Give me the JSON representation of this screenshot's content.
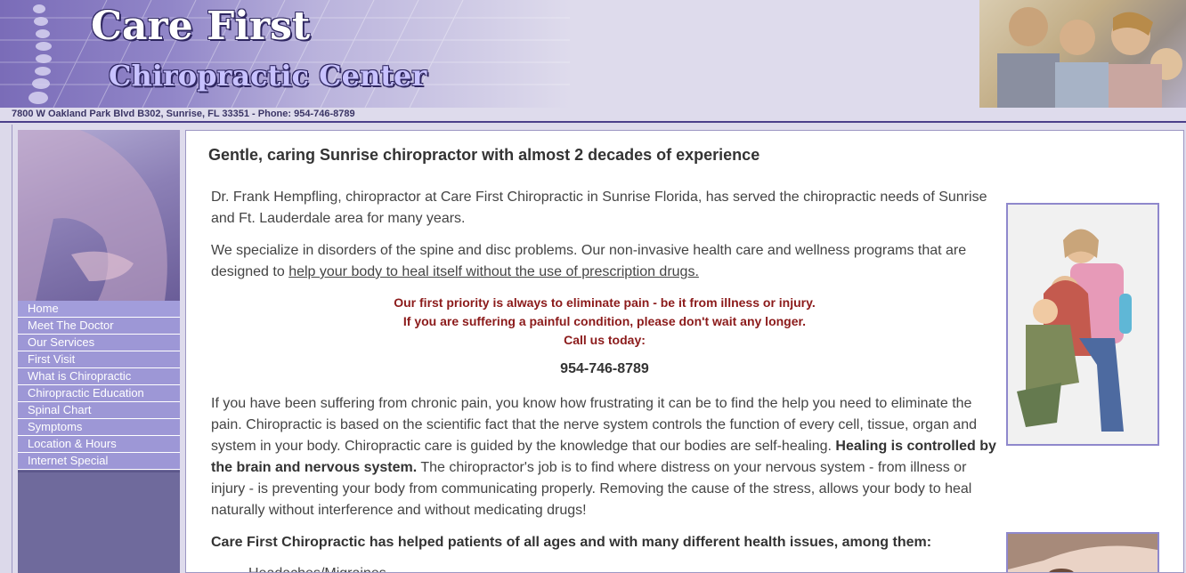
{
  "header": {
    "title": "Care First",
    "subtitle": "Chiropractic Center",
    "address": "7800 W Oakland Park Blvd B302, Sunrise, FL 33351 - Phone: 954-746-8789"
  },
  "nav": {
    "items": [
      {
        "label": "Home"
      },
      {
        "label": "Meet The Doctor"
      },
      {
        "label": "Our Services"
      },
      {
        "label": "First Visit"
      },
      {
        "label": "What is Chiropractic"
      },
      {
        "label": "Chiropractic Education"
      },
      {
        "label": "Spinal Chart"
      },
      {
        "label": "Symptoms"
      },
      {
        "label": "Location & Hours"
      },
      {
        "label": "Internet Special"
      }
    ]
  },
  "content": {
    "headline": "Gentle, caring Sunrise chiropractor with almost 2 decades of experience",
    "p1": "Dr. Frank Hempfling, chiropractor at Care First Chiropractic in Sunrise Florida, has served the chiropractic needs of Sunrise and Ft. Lauderdale area for many years.",
    "p2_start": "We specialize in disorders of the spine and disc problems. Our non-invasive health care and wellness programs that are designed to ",
    "p2_link": "help your body to heal itself without the use of prescription drugs.",
    "alert1": "Our first priority is always to eliminate pain - be it from illness or injury.",
    "alert2": "If you are suffering a painful condition, please don't wait any longer.",
    "alert3": "Call us today:",
    "phone": "954-746-8789",
    "p3_start": "If you have been suffering from chronic pain, you know how frustrating it can be to find the help you need to eliminate the pain. Chiropractic is based on the scientific fact that the nerve system controls the function of every cell, tissue, organ and system in your body. Chiropractic care is guided by the knowledge that our bodies are self-healing. ",
    "p3_bold": "Healing is controlled by the brain and nervous system.",
    "p3_end": " The chiropractor's job is to find where distress on your nervous system - from illness or injury - is preventing your body from communicating properly. Removing the cause of the stress, allows your body to heal naturally without interference and without medicating drugs!",
    "p4": "Care First Chiropractic has helped patients of all ages and with many different health issues, among them:",
    "list_first": "Headaches/Migraines"
  }
}
